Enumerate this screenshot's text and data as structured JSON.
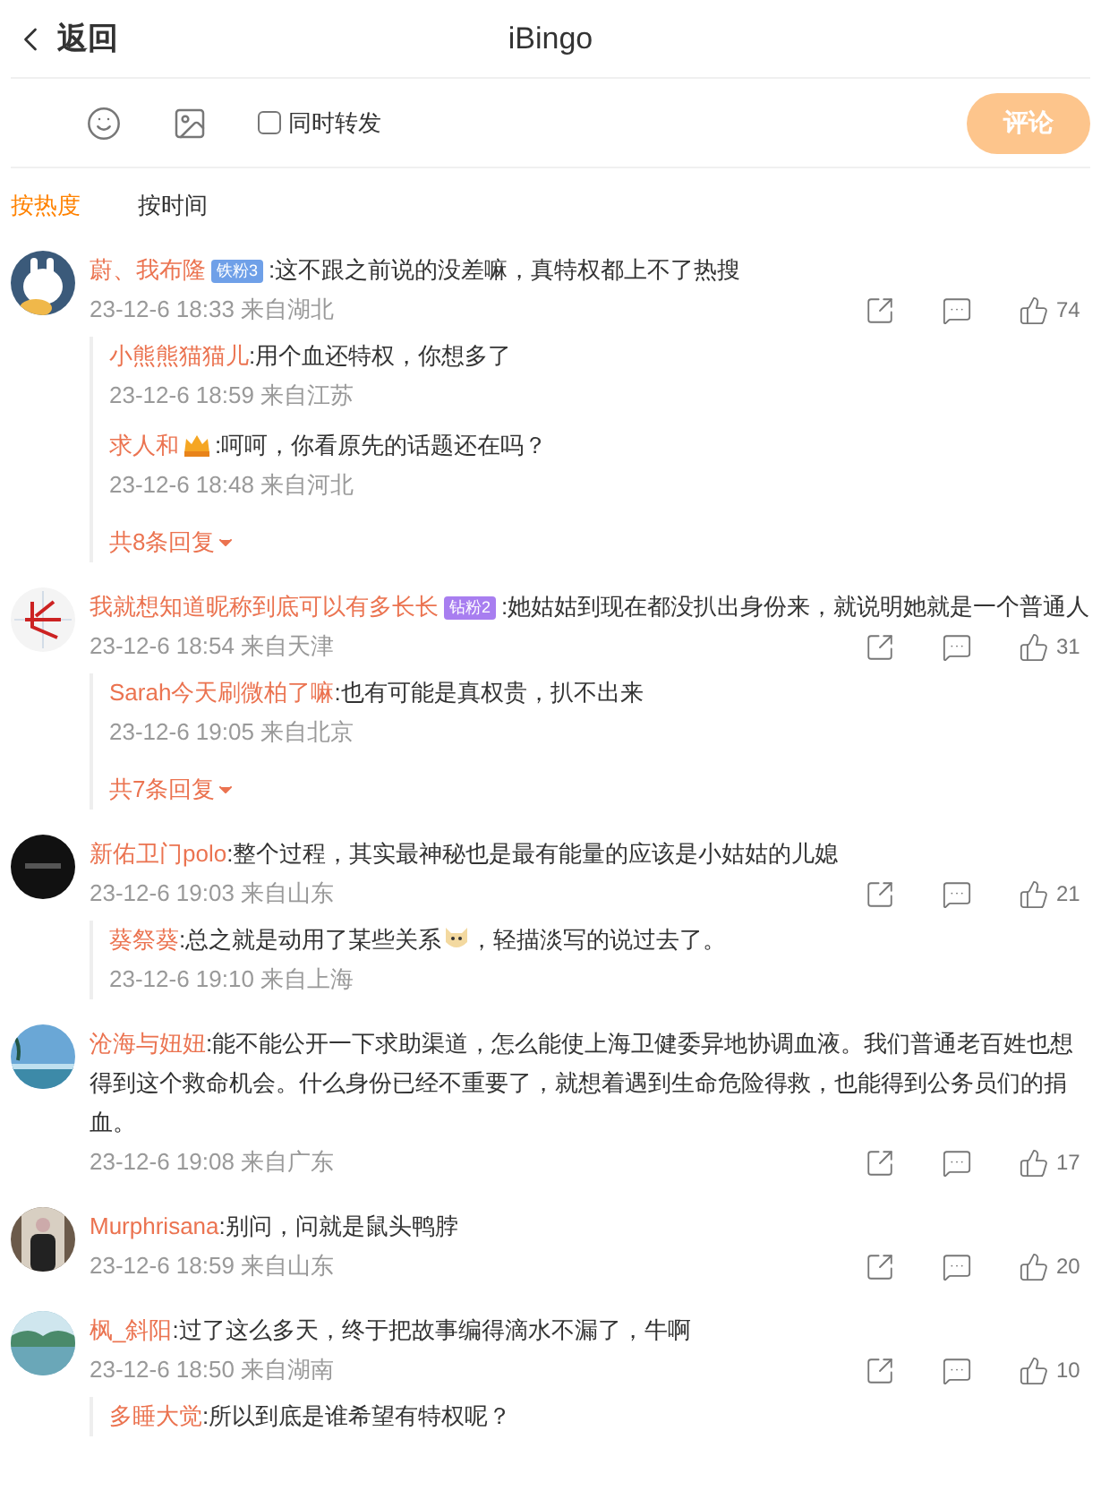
{
  "header": {
    "back": "返回",
    "title": "iBingo"
  },
  "composer": {
    "repost": {
      "label": "同时转发",
      "checked": false
    },
    "submit": {
      "label": "评论",
      "disabled": true
    }
  },
  "tabs": [
    {
      "label": "按热度",
      "selected": true
    },
    {
      "label": "按时间",
      "selected": false
    }
  ],
  "comments": [
    {
      "author": "蔚、我布隆",
      "badge": {
        "kind": "iron",
        "text": "铁粉3"
      },
      "text": ":这不跟之前说的没差嘛，真特权都上不了热搜",
      "time": "23-12-6 18:33 来自湖北",
      "likes": "74",
      "replies": [
        {
          "author": "小熊熊猫猫儿",
          "parts": [
            {
              "kind": "text",
              "text": ":用个血还特权，你想多了"
            }
          ],
          "time": "23-12-6 18:59 来自江苏"
        },
        {
          "author": "求人和",
          "emblem": true,
          "parts": [
            {
              "kind": "text",
              "text": ":呵呵，你看原先的话题还在吗？"
            }
          ],
          "time": "23-12-6 18:48 来自河北"
        }
      ],
      "more": "共8条回复"
    },
    {
      "author": "我就想知道昵称到底可以有多长长",
      "badge": {
        "kind": "diamond",
        "text": "钻粉2"
      },
      "text": ":她姑姑到现在都没扒出身份来，就说明她就是一个普通人",
      "time": "23-12-6 18:54 来自天津",
      "likes": "31",
      "replies": [
        {
          "author": "Sarah今天刷微柏了嘛",
          "parts": [
            {
              "kind": "text",
              "text": ":也有可能是真权贵，扒不出来"
            }
          ],
          "time": "23-12-6 19:05 来自北京"
        }
      ],
      "more": "共7条回复"
    },
    {
      "author": "新佑卫门polo",
      "text": ":整个过程，其实最神秘也是最有能量的应该是小姑姑的儿媳",
      "time": "23-12-6 19:03 来自山东",
      "likes": "21",
      "replies": [
        {
          "author": "葵祭葵",
          "parts": [
            {
              "kind": "text",
              "text": ":总之就是动用了某些关系"
            },
            {
              "kind": "emoji"
            },
            {
              "kind": "text",
              "text": "，轻描淡写的说过去了。"
            }
          ],
          "time": "23-12-6 19:10 来自上海"
        }
      ]
    },
    {
      "author": "沧海与妞妞",
      "text": ":能不能公开一下求助渠道，怎么能使上海卫健委异地协调血液。我们普通老百姓也想得到这个救命机会。什么身份已经不重要了，就想着遇到生命危险得救，也能得到公务员们的捐血。",
      "time": "23-12-6 19:08 来自广东",
      "likes": "17"
    },
    {
      "author": "Murphrisana",
      "text": ":别问，问就是鼠头鸭脖",
      "time": "23-12-6 18:59 来自山东",
      "likes": "20"
    },
    {
      "author": "枫_斜阳",
      "text": ":过了这么多天，终于把故事编得滴水不漏了，牛啊",
      "time": "23-12-6 18:50 来自湖南",
      "likes": "10",
      "replies": [
        {
          "author": "多睡大觉",
          "parts": [
            {
              "kind": "text",
              "text": ":所以到底是谁希望有特权呢？"
            }
          ]
        }
      ]
    }
  ]
}
